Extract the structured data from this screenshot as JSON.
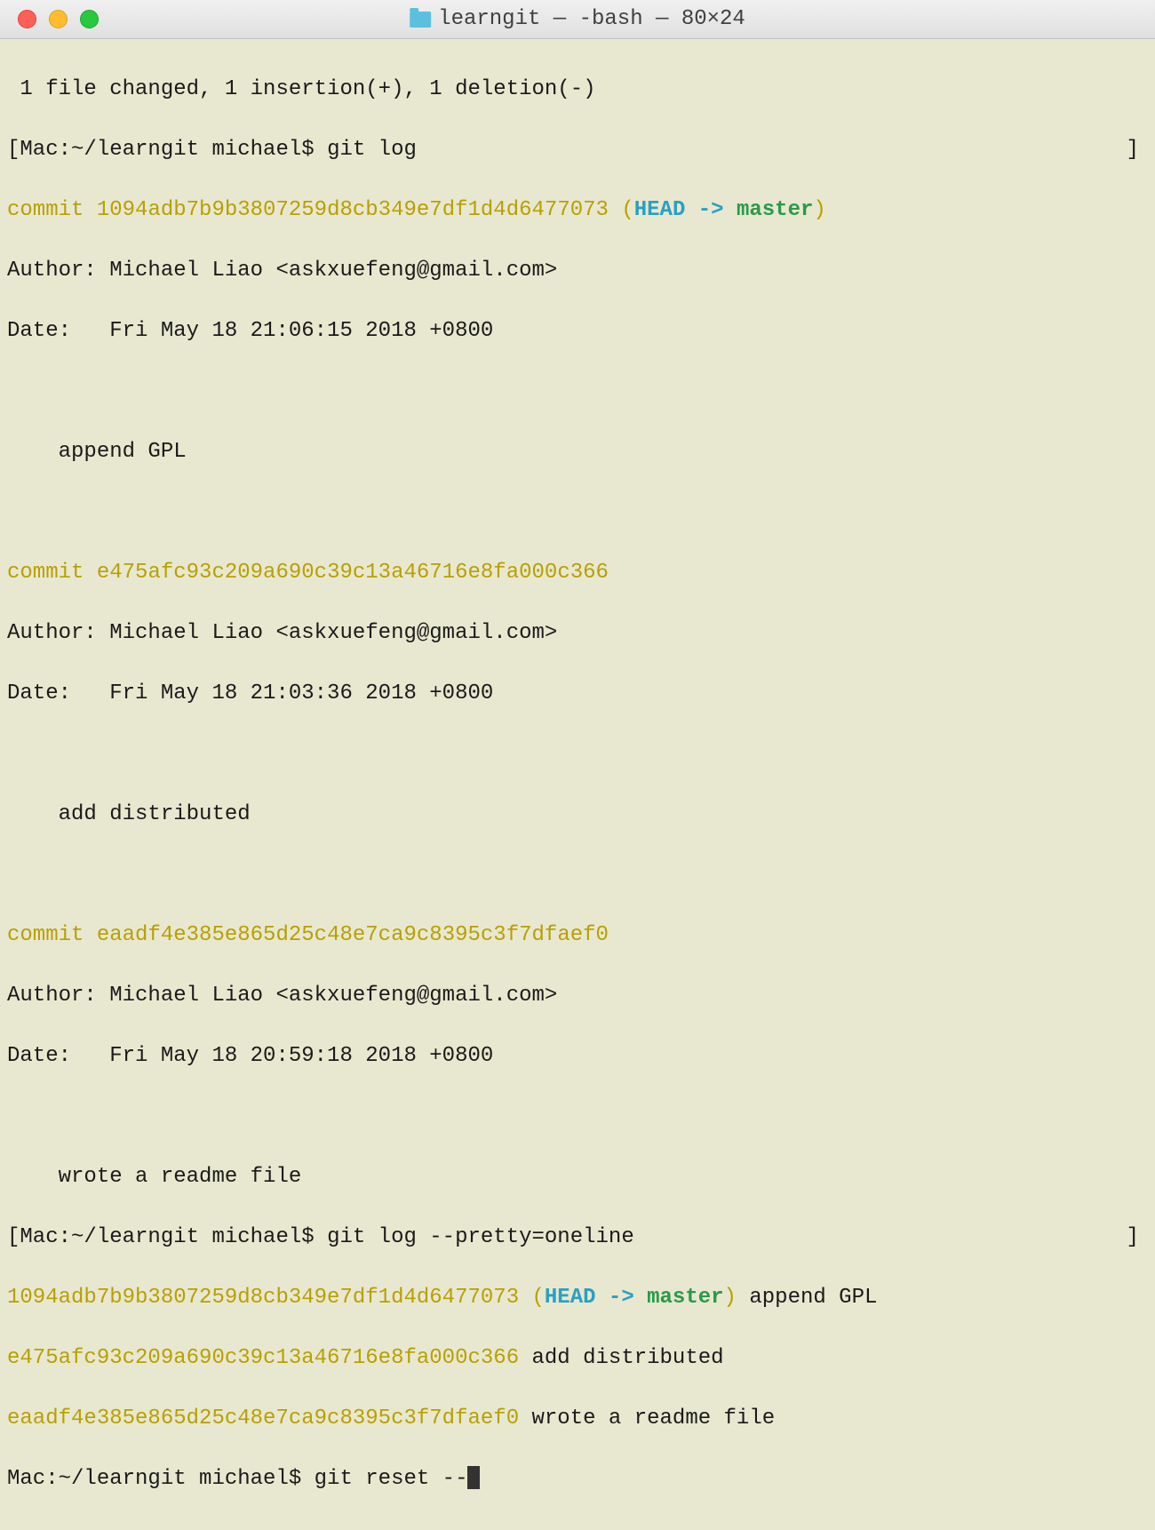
{
  "window": {
    "title": "learngit — -bash — 80×24"
  },
  "terminal": {
    "line1": " 1 file changed, 1 insertion(+), 1 deletion(-)",
    "prompt1_open": "[",
    "prompt1_text": "Mac:~/learngit michael$ git log",
    "prompt1_close": "]",
    "commit1_label": "commit ",
    "commit1_hash": "1094adb7b9b3807259d8cb349e7df1d4d6477073",
    "commit1_paren_open": " (",
    "commit1_head": "HEAD -> ",
    "commit1_branch": "master",
    "commit1_paren_close": ")",
    "commit1_author": "Author: Michael Liao <askxuefeng@gmail.com>",
    "commit1_date": "Date:   Fri May 18 21:06:15 2018 +0800",
    "commit1_blank": " ",
    "commit1_msg": "    append GPL",
    "commit1_blank2": " ",
    "commit2_label": "commit ",
    "commit2_hash": "e475afc93c209a690c39c13a46716e8fa000c366",
    "commit2_author": "Author: Michael Liao <askxuefeng@gmail.com>",
    "commit2_date": "Date:   Fri May 18 21:03:36 2018 +0800",
    "commit2_blank": " ",
    "commit2_msg": "    add distributed",
    "commit2_blank2": " ",
    "commit3_label": "commit ",
    "commit3_hash": "eaadf4e385e865d25c48e7ca9c8395c3f7dfaef0",
    "commit3_author": "Author: Michael Liao <askxuefeng@gmail.com>",
    "commit3_date": "Date:   Fri May 18 20:59:18 2018 +0800",
    "commit3_blank": " ",
    "commit3_msg": "    wrote a readme file",
    "prompt2_open": "[",
    "prompt2_text": "Mac:~/learngit michael$ git log --pretty=oneline",
    "prompt2_close": "]",
    "oneline1_hash": "1094adb7b9b3807259d8cb349e7df1d4d6477073",
    "oneline1_paren_open": " (",
    "oneline1_head": "HEAD -> ",
    "oneline1_branch": "master",
    "oneline1_paren_close": ")",
    "oneline1_msg": " append GPL",
    "oneline2_hash": "e475afc93c209a690c39c13a46716e8fa000c366",
    "oneline2_msg": " add distributed",
    "oneline3_hash": "eaadf4e385e865d25c48e7ca9c8395c3f7dfaef0",
    "oneline3_msg": " wrote a readme file",
    "prompt3": "Mac:~/learngit michael$ git reset --"
  }
}
